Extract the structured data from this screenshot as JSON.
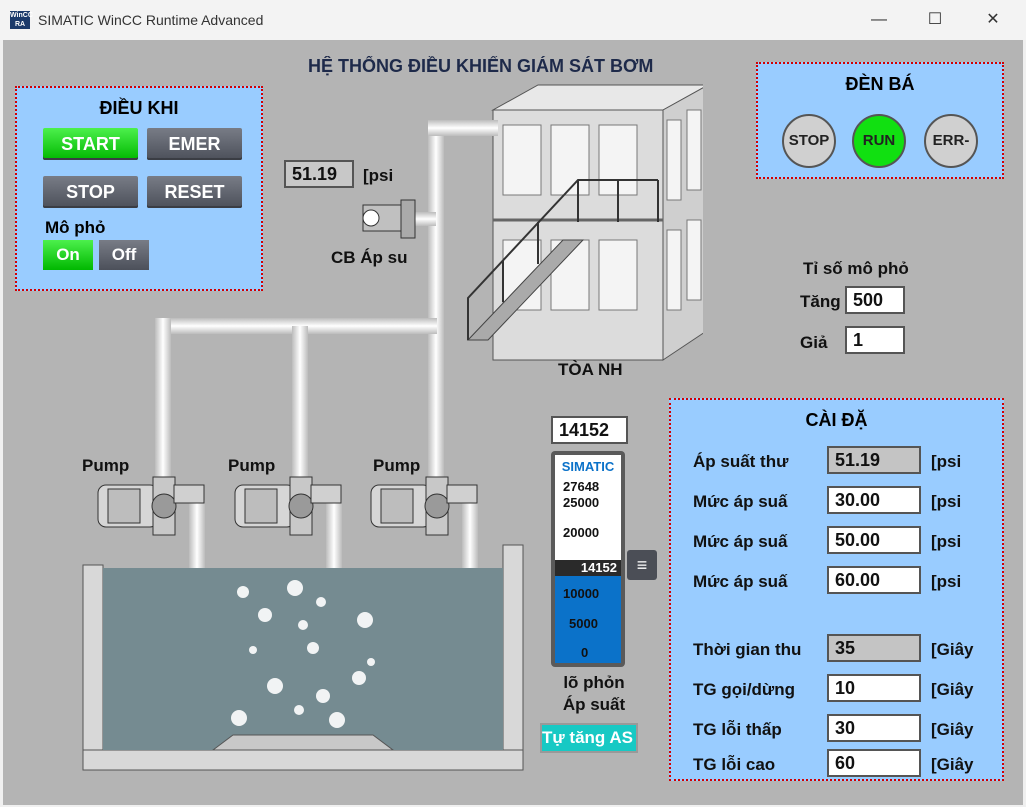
{
  "window": {
    "title": "SIMATIC WinCC Runtime Advanced",
    "icon_text": "WinCC RA",
    "minimize_icon": "minimize-icon",
    "maximize_icon": "maximize-icon",
    "close_icon": "close-icon"
  },
  "header": {
    "title": "HỆ THỐNG ĐIỀU KHIỂN GIÁM SÁT BƠM"
  },
  "control_panel": {
    "title": "ĐIỀU KHI",
    "start_label": "START",
    "emer_label": "EMER",
    "stop_label": "STOP",
    "reset_label": "RESET",
    "sim_label": "Mô phỏ",
    "on_label": "On",
    "off_label": "Off"
  },
  "lamp_panel": {
    "title": "ĐÈN BÁ",
    "stop": "STOP",
    "run": "RUN",
    "err": "ERR-",
    "run_color": "#11e011"
  },
  "sensor": {
    "value": "51.19",
    "unit": "[psi",
    "label": "CB Áp su"
  },
  "building": {
    "label": "TÒA NH"
  },
  "pumps": [
    {
      "label": "Pump"
    },
    {
      "label": "Pump"
    },
    {
      "label": "Pump"
    }
  ],
  "ratio": {
    "title": "Tỉ số mô phỏ",
    "up_label": "Tăng",
    "up_value": "500",
    "down_label": "Giả",
    "down_value": "1"
  },
  "simulator": {
    "value": "14152",
    "brand": "SIMATIC",
    "scale": [
      "27648",
      "25000",
      "20000",
      "10000",
      "5000",
      "0"
    ],
    "max": 27648,
    "current": 14152,
    "caption1": "lõ phỏn",
    "caption2": "Áp suất",
    "auto_button": "Tự tăng AS"
  },
  "settings": {
    "title": "CÀI ĐẶ",
    "rows": [
      {
        "label": "Áp suất thư",
        "value": "51.19",
        "unit": "[psi",
        "readonly": true
      },
      {
        "label": "Mức áp suấ",
        "value": "30.00",
        "unit": "[psi",
        "readonly": false
      },
      {
        "label": "Mức áp suấ",
        "value": "50.00",
        "unit": "[psi",
        "readonly": false
      },
      {
        "label": "Mức áp suấ",
        "value": "60.00",
        "unit": "[psi",
        "readonly": false
      },
      {
        "label": "Thời gian thu",
        "value": "35",
        "unit": "[Giây",
        "readonly": true
      },
      {
        "label": "TG gọi/dừng",
        "value": "10",
        "unit": "[Giây",
        "readonly": false
      },
      {
        "label": "TG lỗi thấp",
        "value": "30",
        "unit": "[Giây",
        "readonly": false
      },
      {
        "label": "TG lỗi cao",
        "value": "60",
        "unit": "[Giây",
        "readonly": false
      }
    ]
  },
  "colors": {
    "panel_bg": "#99ccff",
    "panel_border": "#d40000",
    "canvas_bg": "#b4b4b4",
    "start_green": "#00c800",
    "water": "#758b91",
    "slider_blue": "#0b72c9"
  }
}
